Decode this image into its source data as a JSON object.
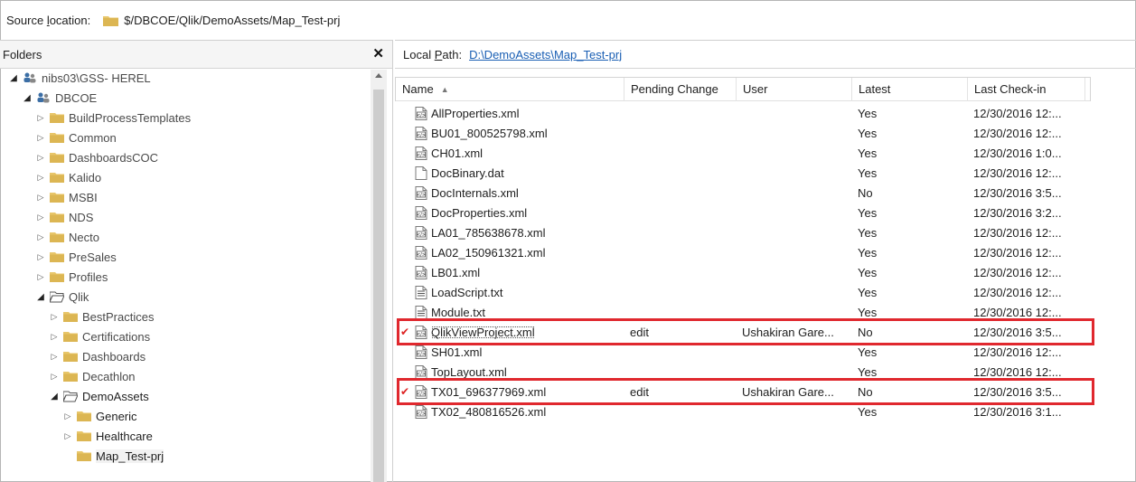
{
  "source": {
    "label_pre": "Source ",
    "label_u": "l",
    "label_post": "ocation:",
    "path": "$/DBCOE/Qlik/DemoAssets/Map_Test-prj"
  },
  "folders_panel": {
    "title": "Folders",
    "close_glyph": "✕"
  },
  "tree": [
    {
      "label": "nibs03\\GSS- HEREL",
      "icon": "team-project-collection-icon",
      "arrow": "expanded"
    },
    {
      "label": "DBCOE",
      "icon": "team-project-icon",
      "arrow": "expanded"
    },
    {
      "label": "BuildProcessTemplates",
      "icon": "folder-icon",
      "arrow": "collapsed"
    },
    {
      "label": "Common",
      "icon": "folder-icon",
      "arrow": "collapsed"
    },
    {
      "label": "DashboardsCOC",
      "icon": "folder-icon",
      "arrow": "collapsed"
    },
    {
      "label": "Kalido",
      "icon": "folder-icon",
      "arrow": "collapsed"
    },
    {
      "label": "MSBI",
      "icon": "folder-icon",
      "arrow": "collapsed"
    },
    {
      "label": "NDS",
      "icon": "folder-icon",
      "arrow": "collapsed"
    },
    {
      "label": "Necto",
      "icon": "folder-icon",
      "arrow": "collapsed"
    },
    {
      "label": "PreSales",
      "icon": "folder-icon",
      "arrow": "collapsed"
    },
    {
      "label": "Profiles",
      "icon": "folder-icon",
      "arrow": "collapsed"
    },
    {
      "label": "Qlik",
      "icon": "folder-open-icon",
      "arrow": "expanded"
    },
    {
      "label": "BestPractices",
      "icon": "folder-icon",
      "arrow": "collapsed"
    },
    {
      "label": "Certifications",
      "icon": "folder-icon",
      "arrow": "collapsed"
    },
    {
      "label": "Dashboards",
      "icon": "folder-icon",
      "arrow": "collapsed"
    },
    {
      "label": "Decathlon",
      "icon": "folder-icon",
      "arrow": "collapsed"
    },
    {
      "label": "DemoAssets",
      "icon": "folder-open-icon",
      "arrow": "expanded"
    },
    {
      "label": "Generic",
      "icon": "folder-icon",
      "arrow": "collapsed"
    },
    {
      "label": "Healthcare",
      "icon": "folder-icon",
      "arrow": "collapsed"
    },
    {
      "label": "Map_Test-prj",
      "icon": "folder-icon",
      "arrow": "none"
    }
  ],
  "local_path": {
    "label_pre": "Local ",
    "label_u": "P",
    "label_post": "ath:",
    "link": "D:\\DemoAssets\\Map_Test-prj"
  },
  "columns": [
    "Name",
    "Pending Change",
    "User",
    "Latest",
    "Last Check-in"
  ],
  "sort_glyph": "▲",
  "files": [
    {
      "name": "AllProperties.xml",
      "icon": "xml-file-icon",
      "pending": "",
      "user": "",
      "latest": "Yes",
      "checkin": "12/30/2016 12:...",
      "checked_out": false
    },
    {
      "name": "BU01_800525798.xml",
      "icon": "xml-file-icon",
      "pending": "",
      "user": "",
      "latest": "Yes",
      "checkin": "12/30/2016 12:...",
      "checked_out": false
    },
    {
      "name": "CH01.xml",
      "icon": "xml-file-icon",
      "pending": "",
      "user": "",
      "latest": "Yes",
      "checkin": "12/30/2016 1:0...",
      "checked_out": false
    },
    {
      "name": "DocBinary.dat",
      "icon": "blank-file-icon",
      "pending": "",
      "user": "",
      "latest": "Yes",
      "checkin": "12/30/2016 12:...",
      "checked_out": false
    },
    {
      "name": "DocInternals.xml",
      "icon": "xml-file-icon",
      "pending": "",
      "user": "",
      "latest": "No",
      "checkin": "12/30/2016 3:5...",
      "checked_out": false
    },
    {
      "name": "DocProperties.xml",
      "icon": "xml-file-icon",
      "pending": "",
      "user": "",
      "latest": "Yes",
      "checkin": "12/30/2016 3:2...",
      "checked_out": false
    },
    {
      "name": "LA01_785638678.xml",
      "icon": "xml-file-icon",
      "pending": "",
      "user": "",
      "latest": "Yes",
      "checkin": "12/30/2016 12:...",
      "checked_out": false
    },
    {
      "name": "LA02_150961321.xml",
      "icon": "xml-file-icon",
      "pending": "",
      "user": "",
      "latest": "Yes",
      "checkin": "12/30/2016 12:...",
      "checked_out": false
    },
    {
      "name": "LB01.xml",
      "icon": "xml-file-icon",
      "pending": "",
      "user": "",
      "latest": "Yes",
      "checkin": "12/30/2016 12:...",
      "checked_out": false
    },
    {
      "name": "LoadScript.txt",
      "icon": "text-file-icon",
      "pending": "",
      "user": "",
      "latest": "Yes",
      "checkin": "12/30/2016 12:...",
      "checked_out": false
    },
    {
      "name": "Module.txt",
      "icon": "text-file-icon",
      "pending": "",
      "user": "",
      "latest": "Yes",
      "checkin": "12/30/2016 12:...",
      "checked_out": false
    },
    {
      "name": "QlikViewProject.xml",
      "icon": "xml-file-icon",
      "pending": "edit",
      "user": "Ushakiran Gare...",
      "latest": "No",
      "checkin": "12/30/2016 3:5...",
      "checked_out": true
    },
    {
      "name": "SH01.xml",
      "icon": "xml-file-icon",
      "pending": "",
      "user": "",
      "latest": "Yes",
      "checkin": "12/30/2016 12:...",
      "checked_out": false
    },
    {
      "name": "TopLayout.xml",
      "icon": "xml-file-icon",
      "pending": "",
      "user": "",
      "latest": "Yes",
      "checkin": "12/30/2016 12:...",
      "checked_out": false
    },
    {
      "name": "TX01_696377969.xml",
      "icon": "xml-file-icon",
      "pending": "edit",
      "user": "Ushakiran Gare...",
      "latest": "No",
      "checkin": "12/30/2016 3:5...",
      "checked_out": true
    },
    {
      "name": "TX02_480816526.xml",
      "icon": "xml-file-icon",
      "pending": "",
      "user": "",
      "latest": "Yes",
      "checkin": "12/30/2016 3:1...",
      "checked_out": false
    }
  ],
  "check_glyph": "✔",
  "colors": {
    "folder": "#e8c66a",
    "highlight": "#e0282e",
    "link": "#1a5fb4"
  }
}
